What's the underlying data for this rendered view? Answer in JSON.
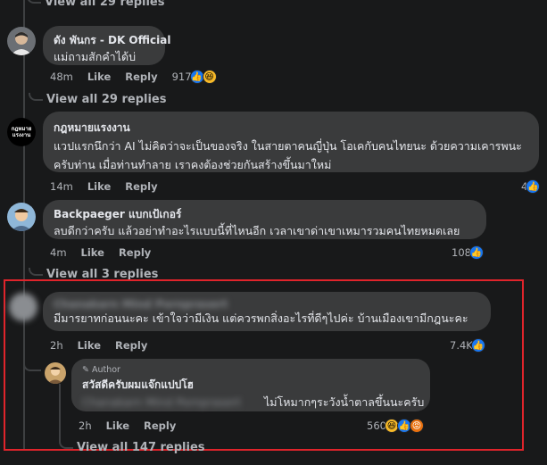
{
  "thread_top": {
    "view_all": "View all 29 replies"
  },
  "comment1": {
    "author": "ดัง พันกร - DK Official",
    "text": "แม่ถามสักคำได้บ่",
    "time": "48m",
    "like": "Like",
    "reply": "Reply",
    "reactions": "917",
    "view_all": "View all 29 replies"
  },
  "comment2": {
    "author": "กฎหมายแรงงาน",
    "avatar_text": "กฎหมาย แรงงาน",
    "text_line1": "แวปแรกนึกว่า AI ไม่คิดว่าจะเป็นของจริง ในสายตาคนญี่ปุ่น โอเคกับคนไทยนะ ด้วยความเคารพนะ",
    "text_line2": "ครับท่าน เมื่อท่านทำลาย เราคงต้องช่วยกันสร้างขึ้นมาใหม่",
    "time": "14m",
    "like": "Like",
    "reply": "Reply",
    "reactions": "4"
  },
  "comment3": {
    "author": "Backpaeger แบกเป้เกอร์",
    "text": "ลบดีกว่าครับ แล้วอย่าทำอะไรแบบนี้ที่ไหนอีก เวลาเขาด่าเขาเหมารวมคนไทยหมดเลย",
    "time": "4m",
    "like": "Like",
    "reply": "Reply",
    "reactions": "108",
    "view_all": "View all 3 replies"
  },
  "comment4": {
    "author": "Chanakarn Mind Pornprasert",
    "text": "มีมารยาทก่อนนะคะ เข้าใจว่ามีเงิน แต่ควรพกสิ่งอะไรที่ดีๆไปค่ะ บ้านเมืองเขามีกฎนะคะ",
    "time": "2h",
    "like": "Like",
    "reply": "Reply",
    "reactions": "7.4K"
  },
  "reply1": {
    "badge": "Author",
    "author": "สวัสดีครับผมแจ๊กแปปโฮ",
    "mention": "Chanakarn Mind Pornprasert",
    "text": "ไม่โหมากๆระวังน้ำตาลขึ้นนะครับ",
    "time": "2h",
    "like": "Like",
    "reply": "Reply",
    "reactions": "560",
    "view_all": "View all 147 replies"
  },
  "colors": {
    "background": "#18191a",
    "bubble": "#3a3b3c",
    "like_blue": "#1877f2",
    "highlight": "#e0242b"
  }
}
